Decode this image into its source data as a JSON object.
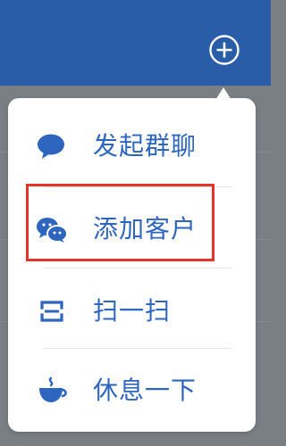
{
  "header": {
    "add_icon": "plus-circle-icon",
    "color": "#2a5da8"
  },
  "menu": {
    "accent_color": "#2d65bf",
    "items": [
      {
        "label": "发起群聊",
        "icon": "chat-bubble-icon"
      },
      {
        "label": "添加客户",
        "icon": "wechat-icon"
      },
      {
        "label": "扫一扫",
        "icon": "scan-icon"
      },
      {
        "label": "休息一下",
        "icon": "coffee-cup-icon"
      }
    ]
  },
  "highlight": {
    "target": "添加客户",
    "color": "#e3342c"
  }
}
